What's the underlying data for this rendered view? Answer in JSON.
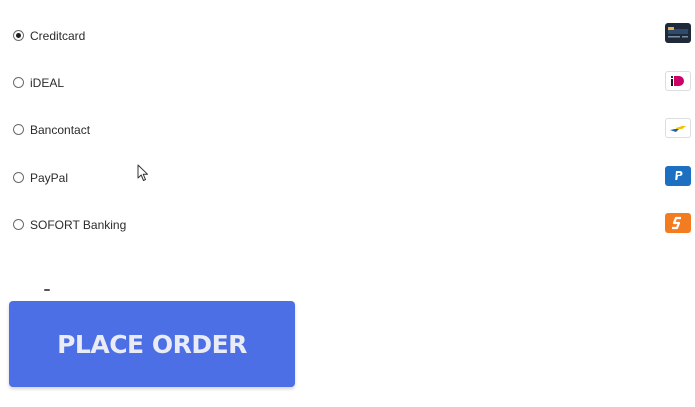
{
  "payment_methods": [
    {
      "label": "Creditcard",
      "selected": true,
      "icon": "creditcard-icon"
    },
    {
      "label": "iDEAL",
      "selected": false,
      "icon": "ideal-icon"
    },
    {
      "label": "Bancontact",
      "selected": false,
      "icon": "bancontact-icon"
    },
    {
      "label": "PayPal",
      "selected": false,
      "icon": "paypal-icon"
    },
    {
      "label": "SOFORT Banking",
      "selected": false,
      "icon": "sofort-icon"
    }
  ],
  "place_order": {
    "label": "PLACE ORDER"
  },
  "colors": {
    "button_bg": "#4d6fe5",
    "button_text": "#e9ecf5",
    "paypal_blue": "#1d6fc2",
    "sofort_orange": "#f47c20",
    "ideal_pink": "#cc0066",
    "creditcard_dark": "#1e2a3a"
  }
}
